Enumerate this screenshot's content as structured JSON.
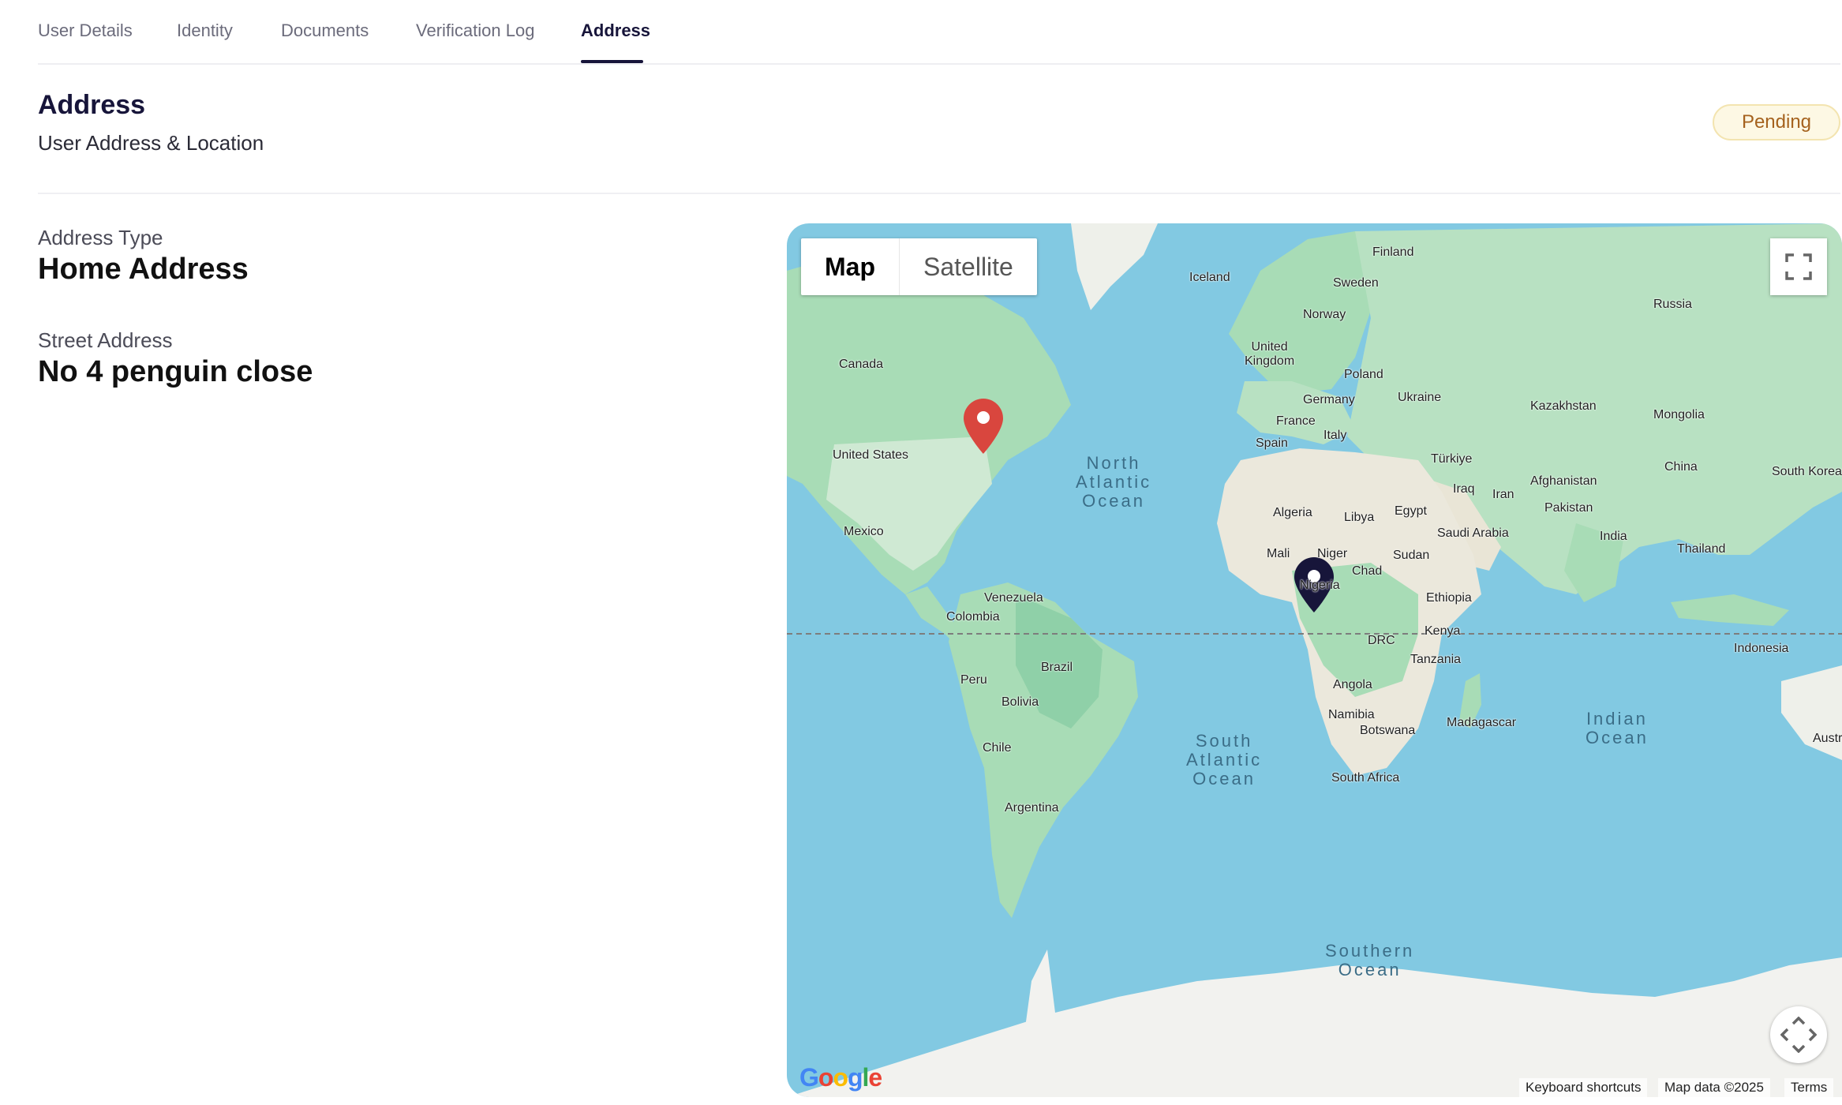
{
  "tabs": [
    {
      "label": "User Details",
      "active": false
    },
    {
      "label": "Identity",
      "active": false
    },
    {
      "label": "Documents",
      "active": false
    },
    {
      "label": "Verification Log",
      "active": false
    },
    {
      "label": "Address",
      "active": true
    }
  ],
  "section": {
    "title": "Address",
    "subtitle": "User Address & Location",
    "status": "Pending"
  },
  "fields": [
    {
      "label": "Address Type",
      "value": "Home Address"
    },
    {
      "label": "Street Address",
      "value": "No 4 penguin close"
    }
  ],
  "map": {
    "view_options": [
      "Map",
      "Satellite"
    ],
    "selected_view": "Map",
    "fullscreen_icon": "fullscreen-icon",
    "camera_icon": "camera-control-icon",
    "logo": "Google",
    "attribution": {
      "keyboard": "Keyboard shortcuts",
      "data": "Map data ©2025",
      "terms": "Terms"
    },
    "markers": [
      {
        "name": "red-location-pin-icon",
        "color": "#d9463e"
      },
      {
        "name": "navy-location-pin-icon",
        "color": "#17153a"
      }
    ],
    "labels": {
      "finland": "Finland",
      "iceland": "Iceland",
      "sweden": "Sweden",
      "norway": "Norway",
      "russia": "Russia",
      "uk": "United\nKingdom",
      "poland": "Poland",
      "canada": "Canada",
      "ukraine": "Ukraine",
      "germany": "Germany",
      "kazakhstan": "Kazakhstan",
      "france": "France",
      "mongolia": "Mongolia",
      "spain": "Spain",
      "italy": "Italy",
      "usa": "United States",
      "turkiye": "Türkiye",
      "china": "China",
      "south_korea": "South Korea",
      "iraq": "Iraq",
      "afghanistan": "Afghanistan",
      "iran": "Iran",
      "algeria": "Algeria",
      "libya": "Libya",
      "egypt": "Egypt",
      "pakistan": "Pakistan",
      "mexico": "Mexico",
      "saudi": "Saudi Arabia",
      "india": "India",
      "mali": "Mali",
      "niger": "Niger",
      "sudan": "Sudan",
      "thailand": "Thailand",
      "chad": "Chad",
      "nigeria": "Nigeria",
      "venezuela": "Venezuela",
      "ethiopia": "Ethiopia",
      "colombia": "Colombia",
      "kenya": "Kenya",
      "drc": "DRC",
      "indonesia": "Indonesia",
      "tanzania": "Tanzania",
      "brazil": "Brazil",
      "peru": "Peru",
      "angola": "Angola",
      "bolivia": "Bolivia",
      "namibia": "Namibia",
      "botswana": "Botswana",
      "madagascar": "Madagascar",
      "chile": "Chile",
      "south_africa": "South Africa",
      "argentina": "Argentina",
      "australia": "Australia"
    },
    "oceans": {
      "north_atlantic": "North\nAtlantic\nOcean",
      "south_atlantic": "South\nAtlantic\nOcean",
      "indian": "Indian\nOcean",
      "southern": "Southern\nOcean"
    }
  }
}
